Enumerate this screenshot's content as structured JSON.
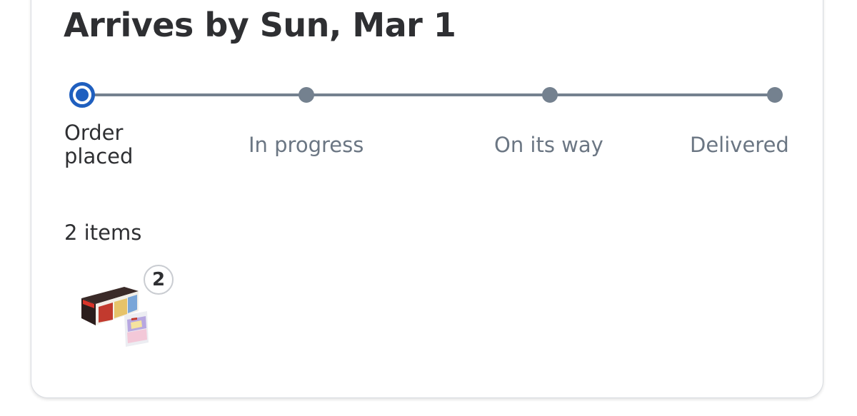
{
  "order": {
    "arrival_title": "Arrives by Sun, Mar 1",
    "items_count_label": "2 items",
    "item_quantity_badge": "2"
  },
  "tracker": {
    "current_step": 1,
    "steps": [
      {
        "label": "Order placed",
        "state": "current"
      },
      {
        "label": "In progress",
        "state": "pending"
      },
      {
        "label": "On its way",
        "state": "pending"
      },
      {
        "label": "Delivered",
        "state": "pending"
      }
    ]
  },
  "colors": {
    "accent": "#1f5fbf",
    "track": "#74818f",
    "text_primary": "#2e2f32",
    "text_muted": "#6b7683"
  }
}
